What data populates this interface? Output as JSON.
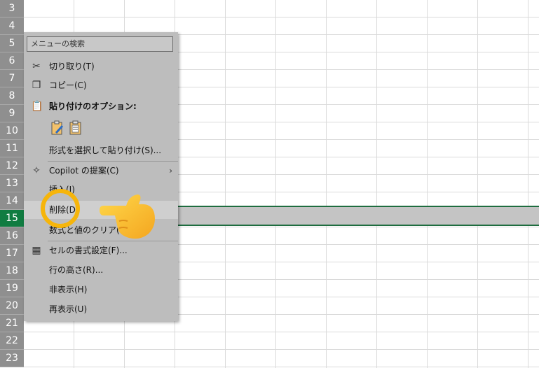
{
  "rows": [
    {
      "n": "3"
    },
    {
      "n": "4"
    },
    {
      "n": "5"
    },
    {
      "n": "6"
    },
    {
      "n": "7"
    },
    {
      "n": "8"
    },
    {
      "n": "9"
    },
    {
      "n": "10"
    },
    {
      "n": "11"
    },
    {
      "n": "12"
    },
    {
      "n": "13"
    },
    {
      "n": "14"
    },
    {
      "n": "15"
    },
    {
      "n": "16"
    },
    {
      "n": "17"
    },
    {
      "n": "18"
    },
    {
      "n": "19"
    },
    {
      "n": "20"
    },
    {
      "n": "21"
    },
    {
      "n": "22"
    },
    {
      "n": "23"
    }
  ],
  "selected_row": "15",
  "menu": {
    "search_placeholder": "メニューの検索",
    "cut": "切り取り(T)",
    "copy": "コピー(C)",
    "paste_header": "貼り付けのオプション:",
    "paste_special": "形式を選択して貼り付け(S)...",
    "copilot": "Copilot の提案(C)",
    "insert": "挿入(I)",
    "delete": "削除(D)",
    "clear": "数式と値のクリア(N)",
    "format_cells": "セルの書式設定(F)...",
    "row_height": "行の高さ(R)...",
    "hide": "非表示(H)",
    "unhide": "再表示(U)"
  },
  "colors": {
    "selected_header": "#107c41",
    "highlight": "#f6b50b"
  }
}
